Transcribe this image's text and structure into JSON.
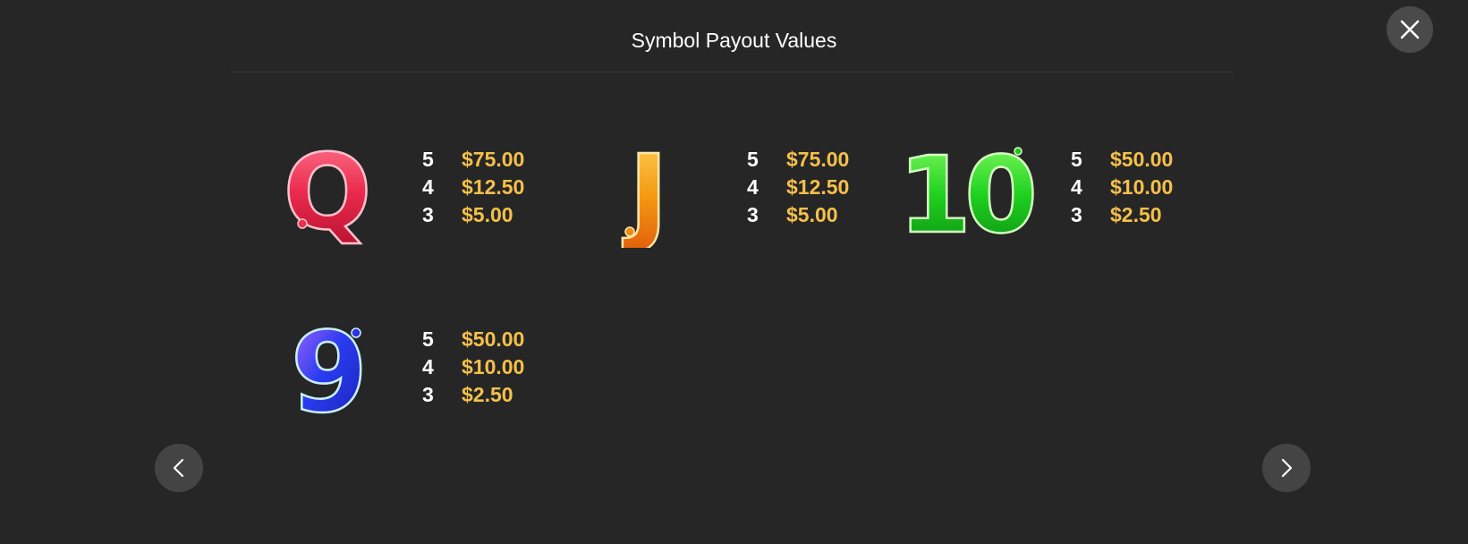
{
  "header": {
    "title": "Symbol Payout Values"
  },
  "symbols": [
    {
      "symbol": "Q",
      "color": "#e8304f",
      "payouts": [
        {
          "count": "5",
          "value": "$75.00"
        },
        {
          "count": "4",
          "value": "$12.50"
        },
        {
          "count": "3",
          "value": "$5.00"
        }
      ]
    },
    {
      "symbol": "J",
      "color": "#f08a10",
      "payouts": [
        {
          "count": "5",
          "value": "$75.00"
        },
        {
          "count": "4",
          "value": "$12.50"
        },
        {
          "count": "3",
          "value": "$5.00"
        }
      ]
    },
    {
      "symbol": "10",
      "color": "#1fc21f",
      "payouts": [
        {
          "count": "5",
          "value": "$50.00"
        },
        {
          "count": "4",
          "value": "$10.00"
        },
        {
          "count": "3",
          "value": "$2.50"
        }
      ]
    },
    {
      "symbol": "9",
      "color": "#2a35e0",
      "payouts": [
        {
          "count": "5",
          "value": "$50.00"
        },
        {
          "count": "4",
          "value": "$10.00"
        },
        {
          "count": "3",
          "value": "$2.50"
        }
      ]
    }
  ],
  "controls": {
    "close_icon": "close-icon",
    "prev_icon": "chevron-left-icon",
    "next_icon": "chevron-right-icon"
  },
  "colors": {
    "background": "#262626",
    "payout_value": "#f5c04a",
    "button": "#4a4a4a"
  }
}
